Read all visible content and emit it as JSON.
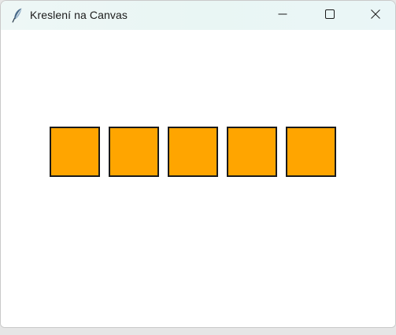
{
  "window": {
    "title": "Kreslení na Canvas",
    "app_icon": "feather-icon",
    "controls": [
      "minimize-icon",
      "maximize-icon",
      "close-icon"
    ]
  },
  "canvas": {
    "background": "#ffffff",
    "squares": [
      {
        "fill": "#ffa500",
        "outline": "#1a1a1a"
      },
      {
        "fill": "#ffa500",
        "outline": "#1a1a1a"
      },
      {
        "fill": "#ffa500",
        "outline": "#1a1a1a"
      },
      {
        "fill": "#ffa500",
        "outline": "#1a1a1a"
      },
      {
        "fill": "#ffa500",
        "outline": "#1a1a1a"
      }
    ]
  }
}
